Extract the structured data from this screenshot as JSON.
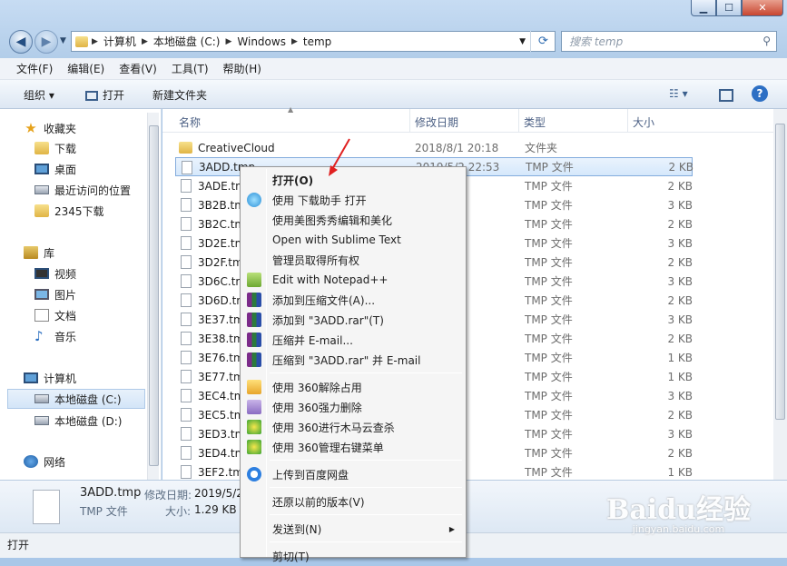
{
  "address": {
    "crumbs": [
      "计算机",
      "本地磁盘 (C:)",
      "Windows",
      "temp"
    ]
  },
  "search": {
    "placeholder": "搜索 temp"
  },
  "menubar": [
    "文件(F)",
    "编辑(E)",
    "查看(V)",
    "工具(T)",
    "帮助(H)"
  ],
  "toolbar": {
    "organize": "组织 ▾",
    "open": "打开",
    "new_folder": "新建文件夹"
  },
  "sidebar": {
    "favorites": "收藏夹",
    "downloads": "下载",
    "desktop": "桌面",
    "recent": "最近访问的位置",
    "dl2345": "2345下载",
    "libraries": "库",
    "videos": "视频",
    "pictures": "图片",
    "documents": "文档",
    "music": "音乐",
    "computer": "计算机",
    "drive_c": "本地磁盘 (C:)",
    "drive_d": "本地磁盘 (D:)",
    "network": "网络"
  },
  "columns": {
    "name": "名称",
    "date": "修改日期",
    "type": "类型",
    "size": "大小"
  },
  "files": [
    {
      "name": "CreativeCloud",
      "date": "2018/8/1 20:18",
      "type": "文件夹",
      "size": ""
    },
    {
      "name": "3ADD.tmp",
      "date": "2019/5/2 22:53",
      "type": "TMP 文件",
      "size": "2 KB"
    },
    {
      "name": "3ADE.tmp",
      "date": "22:53",
      "type": "TMP 文件",
      "size": "2 KB"
    },
    {
      "name": "3B2B.tmp",
      "date": "19:10",
      "type": "TMP 文件",
      "size": "3 KB"
    },
    {
      "name": "3B2C.tmp",
      "date": "19:10",
      "type": "TMP 文件",
      "size": "2 KB"
    },
    {
      "name": "3D2E.tmp",
      "date": "19:08",
      "type": "TMP 文件",
      "size": "3 KB"
    },
    {
      "name": "3D2F.tmp",
      "date": "19:08",
      "type": "TMP 文件",
      "size": "2 KB"
    },
    {
      "name": "3D6C.tmp",
      "date": "7:19",
      "type": "TMP 文件",
      "size": "3 KB"
    },
    {
      "name": "3D6D.tmp",
      "date": "7:19",
      "type": "TMP 文件",
      "size": "2 KB"
    },
    {
      "name": "3E37.tmp",
      "date": "19:11",
      "type": "TMP 文件",
      "size": "3 KB"
    },
    {
      "name": "3E38.tmp",
      "date": "19:11",
      "type": "TMP 文件",
      "size": "2 KB"
    },
    {
      "name": "3E76.tmp",
      "date": "7:11",
      "type": "TMP 文件",
      "size": "1 KB"
    },
    {
      "name": "3E77.tmp",
      "date": "7:11",
      "type": "TMP 文件",
      "size": "1 KB"
    },
    {
      "name": "3EC4.tmp",
      "date": "19:02",
      "type": "TMP 文件",
      "size": "3 KB"
    },
    {
      "name": "3EC5.tmp",
      "date": "19:02",
      "type": "TMP 文件",
      "size": "2 KB"
    },
    {
      "name": "3ED3.tmp",
      "date": "9:12",
      "type": "TMP 文件",
      "size": "3 KB"
    },
    {
      "name": "3ED4.tmp",
      "date": "9:12",
      "type": "TMP 文件",
      "size": "2 KB"
    },
    {
      "name": "3EF2.tmp",
      "date": "7:19",
      "type": "TMP 文件",
      "size": "1 KB"
    }
  ],
  "context_menu": [
    "打开(O)",
    "使用 下载助手 打开",
    "使用美图秀秀编辑和美化",
    "Open with Sublime Text",
    "管理员取得所有权",
    "Edit with Notepad++",
    "添加到压缩文件(A)...",
    "添加到 \"3ADD.rar\"(T)",
    "压缩并 E-mail...",
    "压缩到 \"3ADD.rar\" 并 E-mail",
    "使用 360解除占用",
    "使用 360强力删除",
    "使用 360进行木马云查杀",
    "使用 360管理右键菜单",
    "上传到百度网盘",
    "还原以前的版本(V)",
    "发送到(N)",
    "剪切(T)"
  ],
  "details": {
    "filename": "3ADD.tmp",
    "modified_label": "修改日期:",
    "modified_value": "2019/5/2",
    "type": "TMP 文件",
    "size_label": "大小:",
    "size_value": "1.29 KB"
  },
  "status": "打开",
  "watermark": {
    "text": "Baidu经验",
    "sub": "jingyan.baidu.com"
  }
}
